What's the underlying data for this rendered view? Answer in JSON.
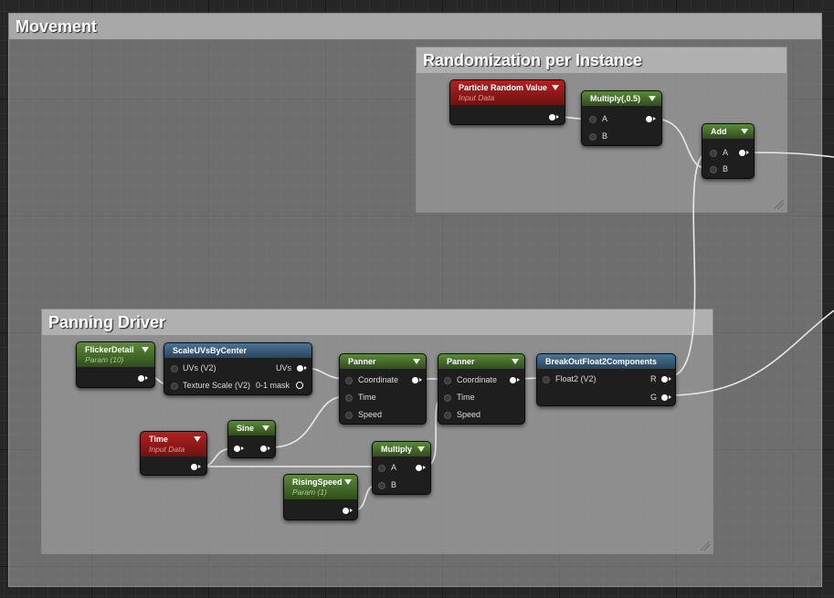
{
  "comments": {
    "movement": "Movement",
    "randomization": "Randomization per Instance",
    "panning": "Panning Driver"
  },
  "nodes": {
    "particle_random": {
      "title": "Particle Random Value",
      "sub": "Input Data"
    },
    "multiply_05": {
      "title": "Multiply(,0.5)",
      "pin_a": "A",
      "pin_b": "B"
    },
    "add": {
      "title": "Add",
      "pin_a": "A",
      "pin_b": "B"
    },
    "flicker": {
      "title": "FlickerDetail",
      "sub": "Param (10)"
    },
    "scaleuvs": {
      "title": "ScaleUVsByCenter",
      "in1": "UVs (V2)",
      "in2": "Texture Scale (V2)",
      "out1": "UVs",
      "out2": "0-1 mask"
    },
    "panner1": {
      "title": "Panner",
      "in1": "Coordinate",
      "in2": "Time",
      "in3": "Speed"
    },
    "panner2": {
      "title": "Panner",
      "in1": "Coordinate",
      "in2": "Time",
      "in3": "Speed"
    },
    "breakout": {
      "title": "BreakOutFloat2Components",
      "in1": "Float2 (V2)",
      "out_r": "R",
      "out_g": "G"
    },
    "time": {
      "title": "Time",
      "sub": "Input Data"
    },
    "sine": {
      "title": "Sine"
    },
    "multiply": {
      "title": "Multiply",
      "pin_a": "A",
      "pin_b": "B"
    },
    "rising": {
      "title": "RisingSpeed",
      "sub": "Param (1)"
    }
  },
  "colors": {
    "input_data": "#8e1a1a",
    "param": "#4a7530",
    "function": "#3a5f7e",
    "comment": "#a8a8a8"
  }
}
